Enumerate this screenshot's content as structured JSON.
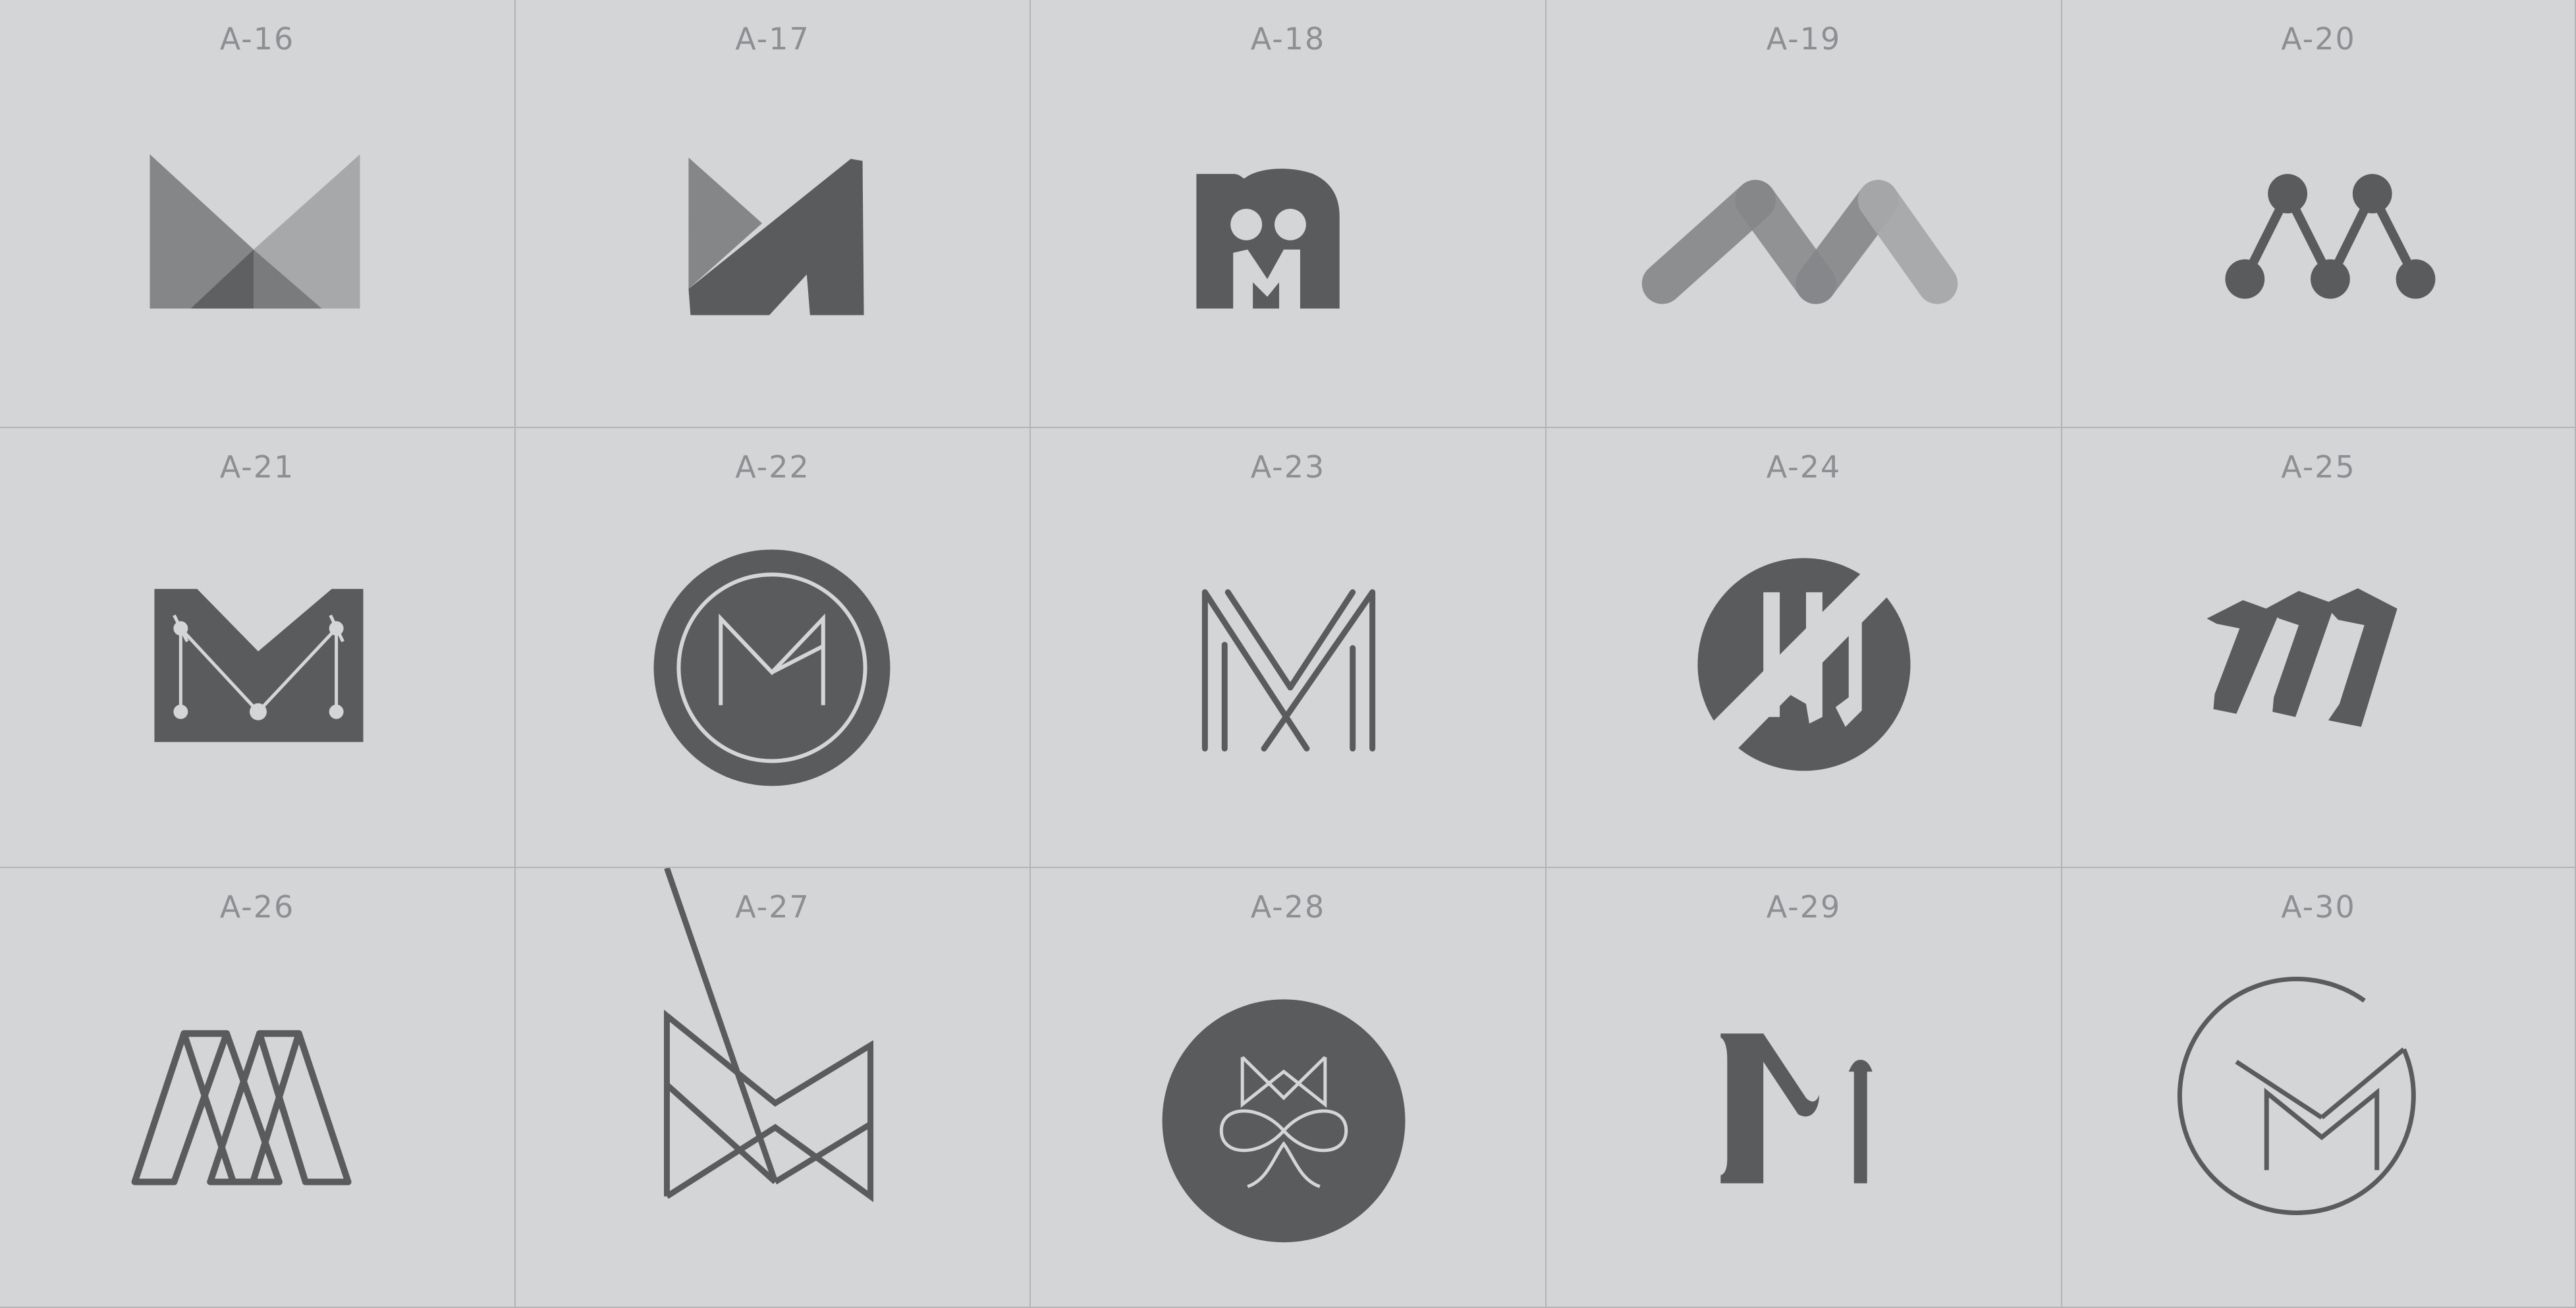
{
  "palette": {
    "background": "#d4d5d7",
    "grid_line": "#b3b4b6",
    "label": "#8d8f92",
    "dark": "#5a5b5d",
    "mid": "#858688",
    "light": "#a7a8aa"
  },
  "logos": [
    {
      "label": "A-16",
      "icon": "geometric-m-icon"
    },
    {
      "label": "A-17",
      "icon": "folded-m-icon"
    },
    {
      "label": "A-18",
      "icon": "two-figures-m-icon"
    },
    {
      "label": "A-19",
      "icon": "ribbon-m-icon"
    },
    {
      "label": "A-20",
      "icon": "node-network-m-icon"
    },
    {
      "label": "A-21",
      "icon": "circuit-m-icon"
    },
    {
      "label": "A-22",
      "icon": "circle-badge-m-icon"
    },
    {
      "label": "A-23",
      "icon": "line-m-icon"
    },
    {
      "label": "A-24",
      "icon": "split-circle-m-icon"
    },
    {
      "label": "A-25",
      "icon": "brush-m-icon"
    },
    {
      "label": "A-26",
      "icon": "double-outline-m-icon"
    },
    {
      "label": "A-27",
      "icon": "bowtie-m-icon"
    },
    {
      "label": "A-28",
      "icon": "infinity-m-icon"
    },
    {
      "label": "A-29",
      "icon": "serif-m-icon"
    },
    {
      "label": "A-30",
      "icon": "circle-check-m-icon"
    }
  ]
}
